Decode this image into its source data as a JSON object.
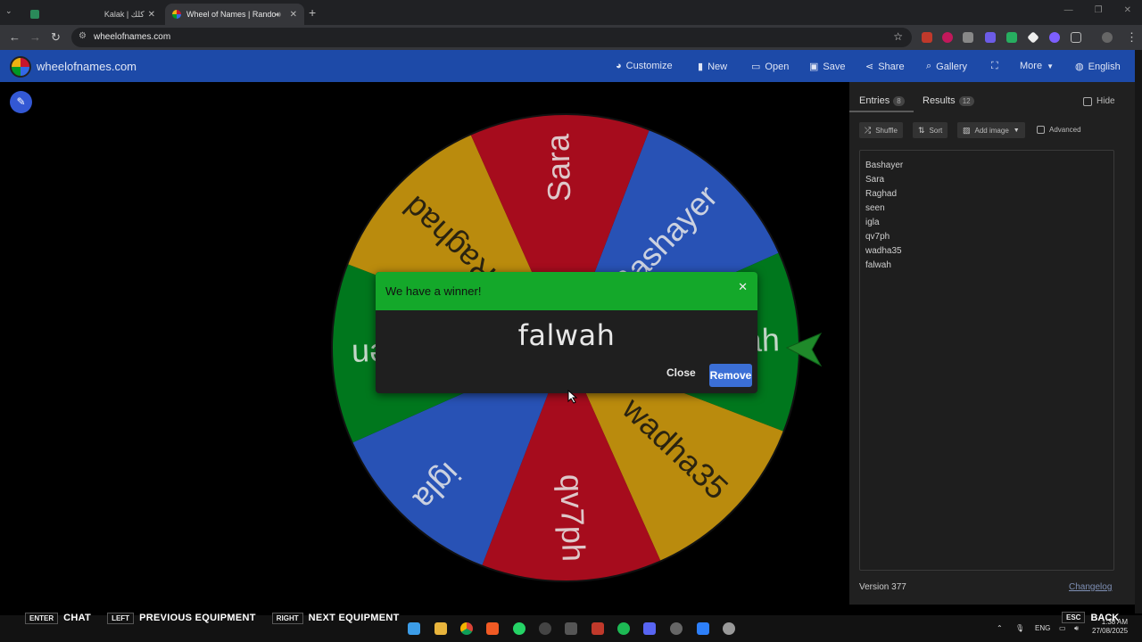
{
  "browser": {
    "tabs": [
      {
        "title": "Kalak | كلك",
        "active": false
      },
      {
        "title": "Wheel of Names | Random",
        "active": true
      }
    ],
    "url": "wheelofnames.com"
  },
  "header": {
    "site_name": "wheelofnames.com",
    "menu": [
      {
        "label": "Customize",
        "icon": "palette-icon"
      },
      {
        "label": "New",
        "icon": "file-icon"
      },
      {
        "label": "Open",
        "icon": "folder-icon"
      },
      {
        "label": "Save",
        "icon": "save-icon"
      },
      {
        "label": "Share",
        "icon": "share-icon"
      },
      {
        "label": "Gallery",
        "icon": "search-icon"
      },
      {
        "label": "",
        "icon": "fullscreen-icon"
      },
      {
        "label": "More",
        "icon": "chevron-down-icon"
      },
      {
        "label": "English",
        "icon": "globe-icon"
      }
    ]
  },
  "wheel": {
    "segments": [
      {
        "label": "Bashayer",
        "color": "#3369e8"
      },
      {
        "label": "falwah",
        "color": "#009925"
      },
      {
        "label": "wadha35",
        "color": "#eeb211"
      },
      {
        "label": "qv7ph",
        "color": "#d50f25"
      },
      {
        "label": "igla",
        "color": "#3369e8"
      },
      {
        "label": "seen",
        "color": "#009925"
      },
      {
        "label": "Raghad",
        "color": "#eeb211"
      },
      {
        "label": "Sara",
        "color": "#d50f25"
      }
    ]
  },
  "modal": {
    "title": "We have a winner!",
    "winner": "falwah",
    "close_label": "Close",
    "remove_label": "Remove"
  },
  "sidebar": {
    "tab_entries": "Entries",
    "entries_count": "8",
    "tab_results": "Results",
    "results_count": "12",
    "hide_label": "Hide",
    "shuffle_label": "Shuffle",
    "sort_label": "Sort",
    "add_image_label": "Add image",
    "advanced_label": "Advanced",
    "entries": [
      "Bashayer",
      "Sara",
      "Raghad",
      "seen",
      "igla",
      "qv7ph",
      "wadha35",
      "falwah"
    ],
    "version": "Version 377",
    "changelog": "Changelog"
  },
  "hints": {
    "enter_key": "ENTER",
    "enter_label": "CHAT",
    "left_key": "LEFT",
    "left_label": "PREVIOUS EQUIPMENT",
    "right_key": "RIGHT",
    "right_label": "NEXT EQUIPMENT",
    "esc_key": "ESC",
    "esc_label": "BACK"
  },
  "taskbar": {
    "lang": "ENG",
    "time": "1:38 AM",
    "date": "27/08/2025"
  }
}
